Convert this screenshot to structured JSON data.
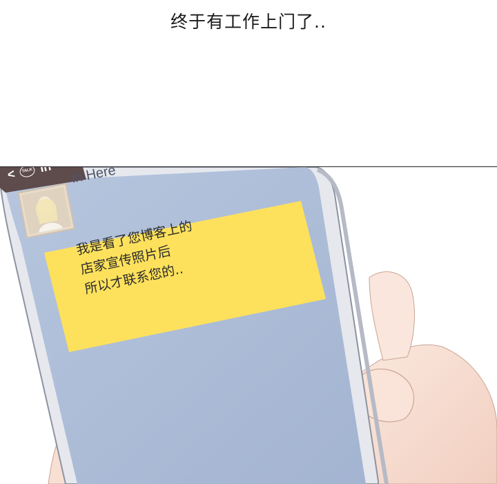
{
  "caption": "终于有工作上门了..",
  "chat": {
    "header_back": "<",
    "header_badge": "TALK",
    "header_title_fragment": "in",
    "contact_label": "in Here",
    "message_lines": [
      "我是看了您博客上的",
      "店家宣传照片后",
      "所以才联系您的.."
    ]
  },
  "colors": {
    "screen": "#aabbd6",
    "message_bubble": "#fde15c",
    "header_bar": "#5e4b4c",
    "skin": "#f6ddd1"
  }
}
